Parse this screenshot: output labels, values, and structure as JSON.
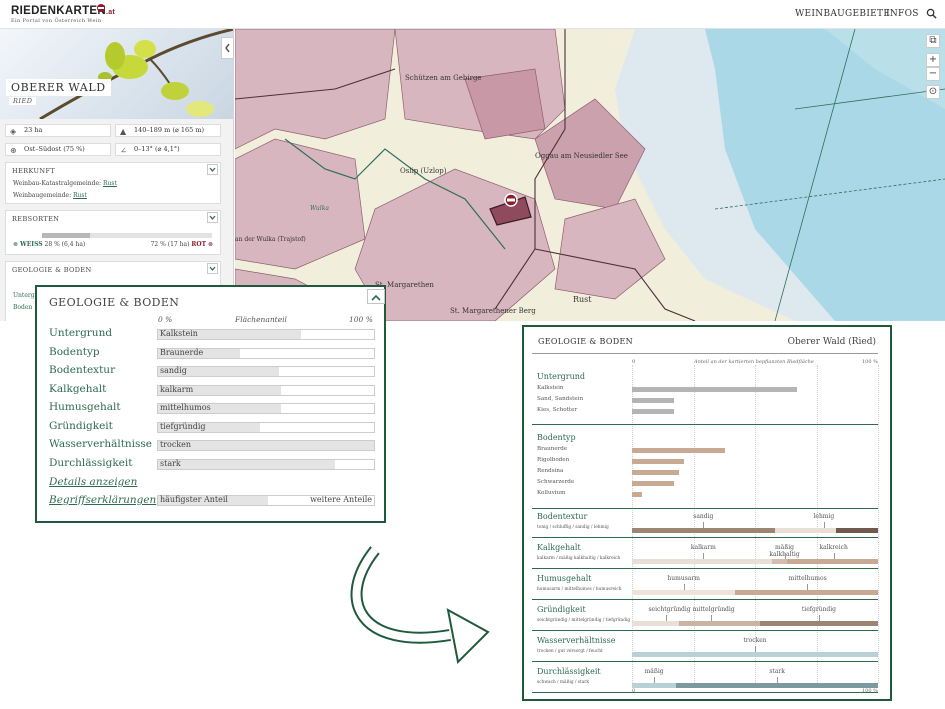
{
  "header": {
    "logo": "RIEDENKARTEN",
    "logo_suffix": ".at",
    "tagline": "Ein Portal von Österreich Wein",
    "nav": [
      "WEINBAUGEBIETE",
      "INFOS"
    ]
  },
  "sidebar": {
    "ried_name": "OBERER WALD",
    "ried_type": "RIED",
    "stats": [
      {
        "icon": "area-icon",
        "text": "23 ha"
      },
      {
        "icon": "mountain-icon",
        "text": "140–189 m (⌀ 165 m)"
      },
      {
        "icon": "compass-icon",
        "text": "Ost–Südost (75 %)"
      },
      {
        "icon": "slope-icon",
        "text": "0–13° (⌀ 4,1°)"
      }
    ],
    "herkunft": {
      "title": "HERKUNFT",
      "row1_label": "Weinbau-Katastralgemeinde:",
      "row1_value": "Rust",
      "row2_label": "Weinbaugemeinde:",
      "row2_value": "Rust"
    },
    "rebsorten": {
      "title": "REBSORTEN",
      "weiss_label": "WEISS",
      "weiss_value": "28 % (6,4 ha)",
      "rot_value": "72 % (17 ha)",
      "rot_label": "ROT",
      "weiss_fraction": 0.28
    },
    "geologie": {
      "title": "GEOLOGIE & BODEN",
      "peek1": "Untergr",
      "peek2": "Boden"
    }
  },
  "map": {
    "labels": [
      "Schützen am Gebirge",
      "Oggau am Neusiedler See",
      "Oslip (Uzlop)",
      "Wulka",
      "St. Margarethen",
      "Rust",
      "St. Margarethener Berg",
      "an der Wulka (Trajstof)"
    ]
  },
  "popup": {
    "title": "GEOLOGIE & BODEN",
    "scale_min": "0 %",
    "scale_label": "Flächenanteil",
    "scale_max": "100 %",
    "rows": [
      {
        "label": "Untergrund",
        "value": "Kalkstein",
        "fraction": 0.66
      },
      {
        "label": "Bodentyp",
        "value": "Braunerde",
        "fraction": 0.38
      },
      {
        "label": "Bodentextur",
        "value": "sandig",
        "fraction": 0.56
      },
      {
        "label": "Kalkgehalt",
        "value": "kalkarm",
        "fraction": 0.57
      },
      {
        "label": "Humusgehalt",
        "value": "mittelhumos",
        "fraction": 0.57
      },
      {
        "label": "Gründigkeit",
        "value": "tiefgründig",
        "fraction": 0.47
      },
      {
        "label": "Wasserverhältnisse",
        "value": "trocken",
        "fraction": 1.0
      },
      {
        "label": "Durchlässigkeit",
        "value": "stark",
        "fraction": 0.82
      }
    ],
    "details_link": "Details anzeigen",
    "glossary_link": "Begriffserklärungen",
    "legend_main": "häufigster Anteil",
    "legend_other": "weitere Anteile"
  },
  "chart": {
    "title": "GEOLOGIE & BODEN",
    "ried": "Oberer Wald (Ried)",
    "axis_min": "0",
    "axis_max": "100 %",
    "axis_caption": "Anteil an der kartierten bepflanzten Riedfläche",
    "colors": {
      "untergrund": "#b4b4b4",
      "bodentyp": "#c8a994",
      "textur_light": "#e8dfd6",
      "textur_dark": "#9b8676"
    }
  },
  "chart_data": {
    "type": "bar",
    "title": "GEOLOGIE & BODEN",
    "xlim": [
      0,
      100
    ],
    "untergrund": {
      "title": "Untergrund",
      "categories": [
        "Kalkstein",
        "Sand, Sandstein",
        "Kies, Schotter"
      ],
      "values": [
        67,
        17,
        17
      ]
    },
    "bodentyp": {
      "title": "Bodentyp",
      "categories": [
        "Braunerde",
        "Rigolboden",
        "Rendsina",
        "Schwarzerde",
        "Kolluvium"
      ],
      "values": [
        38,
        21,
        19,
        17,
        4
      ]
    },
    "scales": [
      {
        "title": "Bodentextur",
        "sub": "tonig / schluffig / sandig / lehmig",
        "labels": [
          {
            "t": "sandig",
            "p": 29
          },
          {
            "t": "lehmig",
            "p": 78
          }
        ],
        "segments": [
          {
            "a": 0,
            "b": 58,
            "c": "#9b8676"
          },
          {
            "a": 58,
            "b": 83,
            "c": "#e8dfd6"
          },
          {
            "a": 83,
            "b": 100,
            "c": "#6f5a4d"
          }
        ]
      },
      {
        "title": "Kalkgehalt",
        "sub": "kalkarm / mäßig kalkhaltig / kalkreich",
        "labels": [
          {
            "t": "kalkarm",
            "p": 29
          },
          {
            "t": "mäßig kalkhaltig",
            "p": 62
          },
          {
            "t": "kalkreich",
            "p": 82
          }
        ],
        "segments": [
          {
            "a": 0,
            "b": 57,
            "c": "#e8dfd6"
          },
          {
            "a": 57,
            "b": 63,
            "c": "#d2beaf"
          },
          {
            "a": 63,
            "b": 100,
            "c": "#c8a994"
          }
        ]
      },
      {
        "title": "Humusgehalt",
        "sub": "humusarm / mittelhumos / humusreich",
        "labels": [
          {
            "t": "humusarm",
            "p": 21
          },
          {
            "t": "mittelhumos",
            "p": 71
          }
        ],
        "segments": [
          {
            "a": 0,
            "b": 42,
            "c": "#ede3d9"
          },
          {
            "a": 42,
            "b": 100,
            "c": "#c8a994"
          }
        ]
      },
      {
        "title": "Gründigkeit",
        "sub": "seichtgründig / mittelgründig / tiefgründig",
        "labels": [
          {
            "t": "seichtgründig",
            "p": 14
          },
          {
            "t": "mittelgründig",
            "p": 32
          },
          {
            "t": "tiefgründig",
            "p": 76
          }
        ],
        "segments": [
          {
            "a": 0,
            "b": 19,
            "c": "#e8dfd6"
          },
          {
            "a": 19,
            "b": 52,
            "c": "#c8b4a5"
          },
          {
            "a": 52,
            "b": 100,
            "c": "#9b8676"
          }
        ]
      },
      {
        "title": "Wasserverhältnisse",
        "sub": "trocken / gut versorgt / feucht",
        "labels": [
          {
            "t": "trocken",
            "p": 50
          }
        ],
        "segments": [
          {
            "a": 0,
            "b": 100,
            "c": "#b8d0d6"
          }
        ]
      },
      {
        "title": "Durchlässigkeit",
        "sub": "schwach / mäßig / stark",
        "labels": [
          {
            "t": "mäßig",
            "p": 9
          },
          {
            "t": "stark",
            "p": 59
          }
        ],
        "segments": [
          {
            "a": 0,
            "b": 18,
            "c": "#b8d0d6"
          },
          {
            "a": 18,
            "b": 100,
            "c": "#7a9aa0"
          }
        ]
      }
    ]
  }
}
